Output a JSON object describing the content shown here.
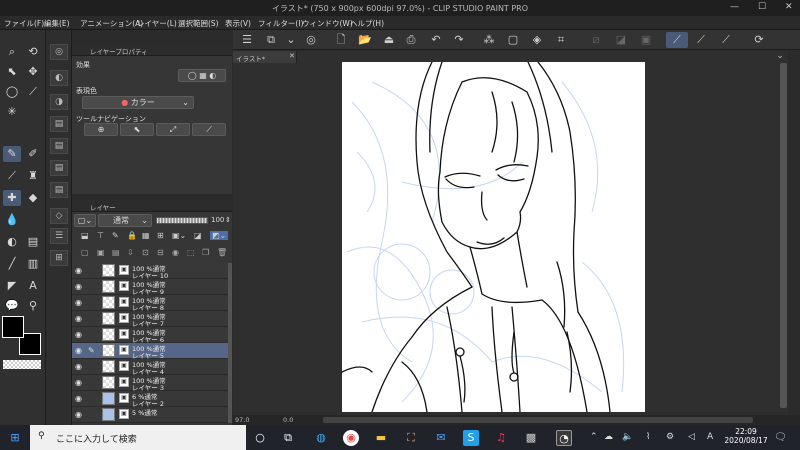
{
  "window": {
    "title": "イラスト* (750 x 900px 600dpi 97.0%)  - CLIP STUDIO PAINT PRO",
    "minimize": "—",
    "maximize": "☐",
    "close": "✕"
  },
  "menu": [
    "ファイル(F)",
    "編集(E)",
    "アニメーション(A)",
    "レイヤー(L)",
    "選択範囲(S)",
    "表示(V)",
    "フィルター(I)",
    "ウィンドウ(W)",
    "ヘルプ(H)"
  ],
  "panels": {
    "layer_property": {
      "title": "レイヤープロパティ",
      "effect_label": "効果",
      "expression_label": "表現色",
      "expression_value": "カラー",
      "tool_nav_label": "ツールナビゲーション"
    },
    "layer": {
      "title": "レイヤー",
      "blend_mode": "通常",
      "opacity": "100"
    }
  },
  "layers": [
    {
      "line1": "100 %通常",
      "line2": "レイヤー 10",
      "selected": false,
      "pen": false,
      "thumb": "checker"
    },
    {
      "line1": "100 %通常",
      "line2": "レイヤー 9",
      "selected": false,
      "pen": false,
      "thumb": "checker"
    },
    {
      "line1": "100 %通常",
      "line2": "レイヤー 8",
      "selected": false,
      "pen": false,
      "thumb": "checker"
    },
    {
      "line1": "100 %通常",
      "line2": "レイヤー 7",
      "selected": false,
      "pen": false,
      "thumb": "checker"
    },
    {
      "line1": "100 %通常",
      "line2": "レイヤー 6",
      "selected": false,
      "pen": false,
      "thumb": "checker"
    },
    {
      "line1": "100 %通常",
      "line2": "レイヤー 5",
      "selected": true,
      "pen": true,
      "thumb": "checker"
    },
    {
      "line1": "100 %通常",
      "line2": "レイヤー 4",
      "selected": false,
      "pen": false,
      "thumb": "checker"
    },
    {
      "line1": "100 %通常",
      "line2": "レイヤー 3",
      "selected": false,
      "pen": false,
      "thumb": "checker"
    },
    {
      "line1": "6 %通常",
      "line2": "レイヤー 2",
      "selected": false,
      "pen": false,
      "thumb": "blue"
    },
    {
      "line1": "5 %通常",
      "line2": "",
      "selected": false,
      "pen": false,
      "thumb": "blue"
    }
  ],
  "document_tab": "イラスト*",
  "status": {
    "zoom": "97.0",
    "angle": "0.0"
  },
  "taskbar": {
    "search_placeholder": "ここに入力して検索",
    "time": "22:09",
    "date": "2020/08/17",
    "ime": "A"
  },
  "colors": {
    "accent": "#4a5b78",
    "selected_layer": "#556688",
    "main_color": "#000000",
    "sub_color": "#000000"
  }
}
